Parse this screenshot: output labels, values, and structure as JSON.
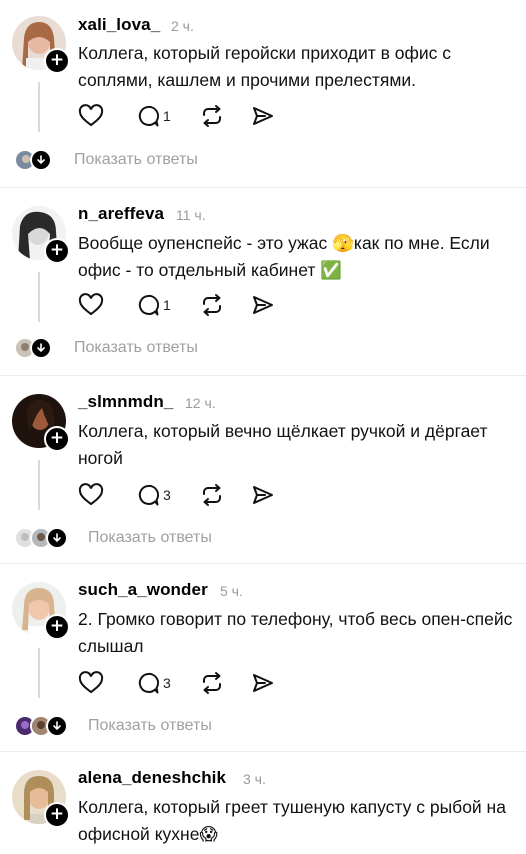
{
  "posts": [
    {
      "username": "xali_lova_",
      "time": "2 ч.",
      "text": "Коллега, который геройски приходит в офис с соплями, кашлем и прочими прелестями.",
      "reply_count": "1",
      "show_replies": "Показать ответы",
      "avatar_color": "#c98d74"
    },
    {
      "username": "n_areffeva",
      "time": "11 ч.",
      "text": "Вообще оупенспейс - это ужас 🫣как по мне. Если офис - то отдельный кабинет ✅",
      "reply_count": "1",
      "show_replies": "Показать ответы",
      "avatar_color": "#6b6b6b"
    },
    {
      "username": "_slmnmdn_",
      "time": "12 ч.",
      "text": "Коллега, который вечно щёлкает ручкой и дёргает ногой",
      "reply_count": "3",
      "show_replies": "Показать ответы",
      "avatar_color": "#3a2418"
    },
    {
      "username": "such_a_wonder",
      "time": "5 ч.",
      "text": "2. Громко говорит по телефону, чтоб весь опен-спейс слышал",
      "reply_count": "3",
      "show_replies": "Показать ответы",
      "avatar_color": "#d8b48e"
    },
    {
      "username": "alena_deneshchik",
      "time": "3 ч.",
      "text": "Коллега, который греет тушеную капусту с рыбой на офисной кухне😱",
      "avatar_color": "#b08e5a"
    }
  ]
}
